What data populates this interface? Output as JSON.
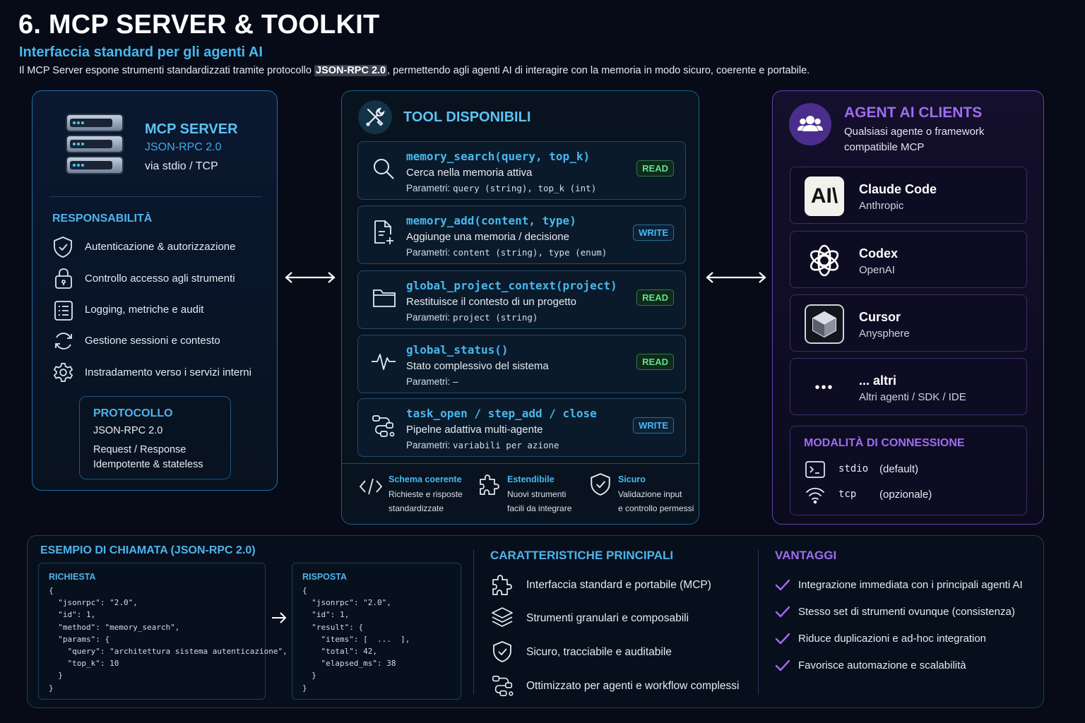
{
  "header": {
    "title": "6. MCP SERVER & TOOLKIT",
    "subtitle": "Interfaccia standard per gli agenti AI",
    "desc_pre": "Il MCP Server espone strumenti standardizzati tramite protocollo ",
    "desc_highlight": "JSON-RPC 2.0",
    "desc_post": ", permettendo agli agenti AI di interagire con la memoria in modo sicuro, coerente e portabile."
  },
  "server": {
    "title": "MCP SERVER",
    "protocol": "JSON-RPC 2.0",
    "transport": "via stdio / TCP",
    "responsibilities_title": "RESPONSABILITÀ",
    "responsibilities": [
      {
        "icon": "shield-check-icon",
        "label": "Autenticazione & autorizzazione"
      },
      {
        "icon": "lock-icon",
        "label": "Controllo accesso agli strumenti"
      },
      {
        "icon": "list-icon",
        "label": "Logging, metriche e audit"
      },
      {
        "icon": "refresh-icon",
        "label": "Gestione sessioni e contesto"
      },
      {
        "icon": "gear-icon",
        "label": "Instradamento verso i servizi interni"
      }
    ],
    "protocol_box": {
      "title": "PROTOCOLLO",
      "line1": "JSON-RPC 2.0",
      "line2": "Request / Response",
      "line3": "Idempotente & stateless"
    }
  },
  "tools": {
    "title": "TOOL DISPONIBILI",
    "items": [
      {
        "icon": "search-icon",
        "name": "memory_search(query, top_k)",
        "desc": "Cerca nella memoria attiva",
        "params_label": "Parametri: ",
        "params": "query (string), top_k (int)",
        "badge": "READ",
        "badge_type": "read"
      },
      {
        "icon": "doc-add-icon",
        "name": "memory_add(content, type)",
        "desc": "Aggiunge una memoria / decisione",
        "params_label": "Parametri: ",
        "params": "content (string), type (enum)",
        "badge": "WRITE",
        "badge_type": "write"
      },
      {
        "icon": "folder-icon",
        "name": "global_project_context(project)",
        "desc": "Restituisce il contesto di un progetto",
        "params_label": "Parametri: ",
        "params": "project (string)",
        "badge": "READ",
        "badge_type": "read"
      },
      {
        "icon": "pulse-icon",
        "name": "global_status()",
        "desc": "Stato complessivo del sistema",
        "params_label": "Parametri: ",
        "params": "–",
        "badge": "READ",
        "badge_type": "read"
      },
      {
        "icon": "workflow-icon",
        "name": "task_open / step_add / close",
        "desc": "Pipelne adattiva multi-agente",
        "params_label": "Parametri: ",
        "params": "variabili per azione",
        "badge": "WRITE",
        "badge_type": "write"
      }
    ],
    "features": [
      {
        "icon": "code-icon",
        "title": "Schema coerente",
        "line1": "Richieste e risposte",
        "line2": "standardizzate"
      },
      {
        "icon": "puzzle-icon",
        "title": "Estendibile",
        "line1": "Nuovi strumenti",
        "line2": "facili da integrare"
      },
      {
        "icon": "shield-check-icon",
        "title": "Sicuro",
        "line1": "Validazione input",
        "line2": "e controllo permessi"
      }
    ]
  },
  "clients": {
    "title": "AGENT AI CLIENTS",
    "subtitle1": "Qualsiasi agente o framework",
    "subtitle2": "compatibile MCP",
    "items": [
      {
        "logo_text": "AI\\",
        "name": "Claude Code",
        "org": "Anthropic"
      },
      {
        "logo_text": "",
        "name": "Codex",
        "org": "OpenAI"
      },
      {
        "logo_text": "",
        "name": "Cursor",
        "org": "Anysphere"
      },
      {
        "logo_text": "•••",
        "name": "... altri",
        "org": "Altri agenti / SDK / IDE"
      }
    ],
    "connection_title": "MODALITÀ DI CONNESSIONE",
    "connections": [
      {
        "icon": "terminal-icon",
        "mode": "stdio",
        "note": "(default)"
      },
      {
        "icon": "wifi-icon",
        "mode": "tcp",
        "note": "(opzionale)"
      }
    ]
  },
  "example": {
    "title": "ESEMPIO DI CHIAMATA (JSON-RPC 2.0)",
    "request_title": "RICHIESTA",
    "request_code": "{\n  \"jsonrpc\": \"2.0\",\n  \"id\": 1,\n  \"method\": \"memory_search\",\n  \"params\": {\n    \"query\": \"architettura sistema autenticazione\",\n    \"top_k\": 10\n  }\n}",
    "response_title": "RISPOSTA",
    "response_code": "{\n  \"jsonrpc\": \"2.0\",\n  \"id\": 1,\n  \"result\": {\n    \"items\": [  ...  ],\n    \"total\": 42,\n    \"elapsed_ms\": 38\n  }\n}"
  },
  "characteristics": {
    "title": "CARATTERISTICHE PRINCIPALI",
    "items": [
      {
        "icon": "puzzle-icon",
        "label": "Interfaccia standard e portabile (MCP)"
      },
      {
        "icon": "layers-icon",
        "label": "Strumenti granulari e composabili"
      },
      {
        "icon": "shield-check-icon",
        "label": "Sicuro, tracciabile e auditabile"
      },
      {
        "icon": "workflow-icon",
        "label": "Ottimizzato per agenti e workflow complessi"
      }
    ]
  },
  "advantages": {
    "title": "VANTAGGI",
    "items": [
      "Integrazione immediata con i principali agenti AI",
      "Stesso set di strumenti ovunque (consistenza)",
      "Riduce duplicazioni e ad-hoc integration",
      "Favorisce automazione e scalabilità"
    ]
  },
  "colors": {
    "background": "#060b17",
    "accent_blue": "#46b9ef",
    "accent_purple": "#a06cf0",
    "read_green": "#66df8a"
  }
}
